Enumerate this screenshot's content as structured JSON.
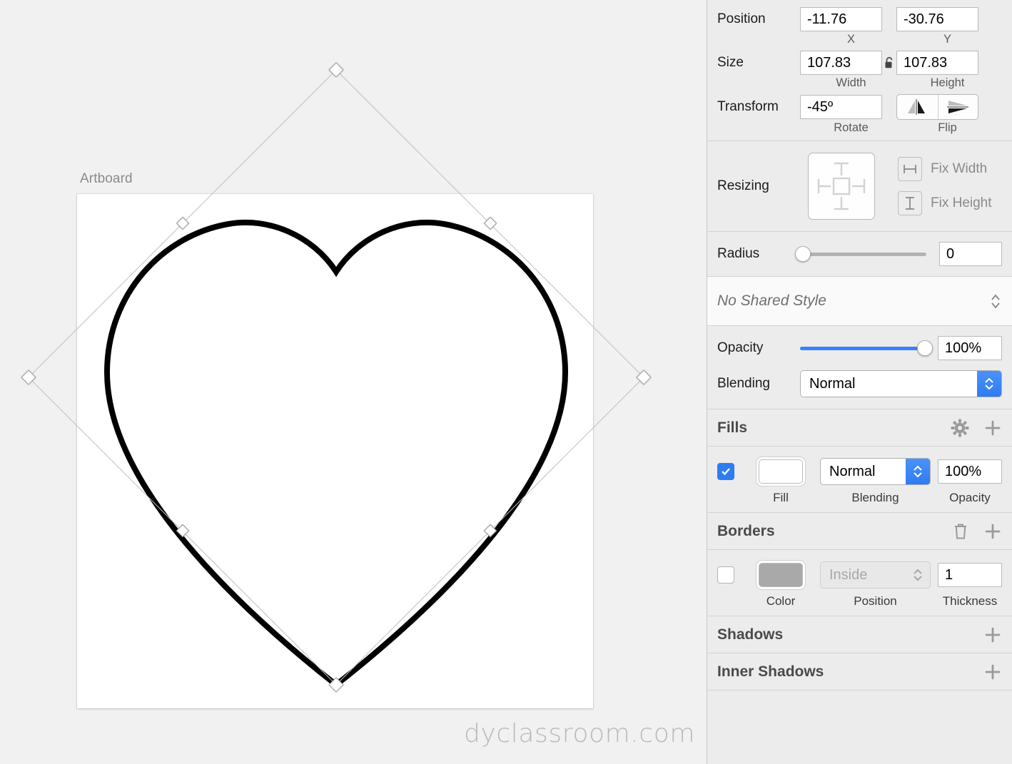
{
  "canvas": {
    "artboard_label": "Artboard",
    "watermark": "dyclassroom.com",
    "shape": "heart",
    "shape_fill": "#ffffff",
    "shape_stroke": "#000000",
    "handle_fill": "#ffffff",
    "handle_border": "#9a9a9a",
    "artboard_bg": "#ffffff",
    "canvas_bg": "#f1f1f1"
  },
  "inspector": {
    "geometry": {
      "position_label": "Position",
      "x_value": "-11.76",
      "x_sub": "X",
      "y_value": "-30.76",
      "y_sub": "Y",
      "size_label": "Size",
      "width_value": "107.83",
      "width_sub": "Width",
      "height_value": "107.83",
      "height_sub": "Height",
      "lock_icon": "unlock-icon",
      "transform_label": "Transform",
      "rotate_value": "-45º",
      "rotate_sub": "Rotate",
      "flip_sub": "Flip",
      "flip_horizontal_icon": "flip-horizontal-icon",
      "flip_vertical_icon": "flip-vertical-icon"
    },
    "resizing": {
      "label": "Resizing",
      "fix_width_label": "Fix Width",
      "fix_height_label": "Fix Height",
      "fix_width_icon": "fix-width-icon",
      "fix_height_icon": "fix-height-icon",
      "widget_icon": "resize-anchor-icon"
    },
    "radius": {
      "label": "Radius",
      "value": "0",
      "slider_percent": 0
    },
    "shared_style": {
      "text": "No Shared Style",
      "stepper_icon": "chevron-updown-icon"
    },
    "opacity": {
      "label": "Opacity",
      "value": "100%",
      "slider_percent": 100,
      "accent": "#3a82f7",
      "blending_label": "Blending",
      "blending_value": "Normal"
    },
    "fills": {
      "title": "Fills",
      "gear_icon": "gear-icon",
      "add_icon": "plus-icon",
      "enabled": true,
      "fill_color": "#ffffff",
      "blending_value": "Normal",
      "opacity_value": "100%",
      "fill_sub": "Fill",
      "blending_sub": "Blending",
      "opacity_sub": "Opacity"
    },
    "borders": {
      "title": "Borders",
      "delete_icon": "trash-icon",
      "add_icon": "plus-icon",
      "enabled": false,
      "color_swatch": "#a9a9a9",
      "position_value": "Inside",
      "thickness_value": "1",
      "color_sub": "Color",
      "position_sub": "Position",
      "thickness_sub": "Thickness"
    },
    "shadows": {
      "title": "Shadows",
      "add_icon": "plus-icon"
    },
    "inner_shadows": {
      "title": "Inner Shadows",
      "add_icon": "plus-icon"
    }
  }
}
